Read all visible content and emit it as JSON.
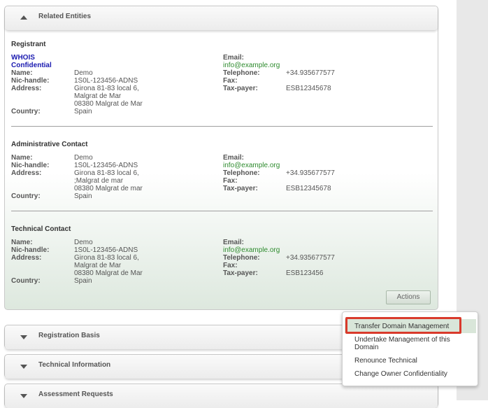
{
  "panels": {
    "related": "Related Entities",
    "registration": "Registration Basis",
    "technical_info": "Technical Information",
    "assessment": "Assessment Requests"
  },
  "registrant": {
    "title": "Registrant",
    "whois_line1": "WHOIS",
    "whois_line2": "Confidential",
    "name_label": "Name:",
    "name": "Demo",
    "nic_label": "Nic-handle:",
    "nic": "1S0L-123456-ADNS",
    "address_label": "Address:",
    "address1": "Girona 81-83 local 6,",
    "address2": "Malgrat de Mar",
    "address3": "08380 Malgrat de Mar",
    "country_label": "Country:",
    "country": "Spain",
    "email_label": "Email:",
    "email": "info@example.org",
    "phone_label": "Telephone:",
    "phone": "+34.935677577",
    "fax_label": "Fax:",
    "tax_label": "Tax-payer:",
    "tax": "ESB12345678"
  },
  "admin": {
    "title": "Administrative Contact",
    "name_label": "Name:",
    "name": "Demo",
    "nic_label": "Nic-handle:",
    "nic": "1S0L-123456-ADNS",
    "address_label": "Address:",
    "address1": "Girona 81-83 local 6,",
    "address2": ";Malgrat de mar",
    "address3": "08380 Malgrat de mar",
    "country_label": "Country:",
    "country": "Spain",
    "email_label": "Email:",
    "email": "info@example.org",
    "phone_label": "Telephone:",
    "phone": "+34.935677577",
    "fax_label": "Fax:",
    "tax_label": "Tax-payer:",
    "tax": "ESB12345678"
  },
  "technical": {
    "title": "Technical Contact",
    "name_label": "Name:",
    "name": "Demo",
    "nic_label": "Nic-handle:",
    "nic": "1S0L-123456-ADNS",
    "address_label": "Address:",
    "address1": "Girona 81-83 local 6,",
    "address2": "Malgrat de Mar",
    "address3": "08380 Malgrat de Mar",
    "country_label": "Country:",
    "country": "Spain",
    "email_label": "Email:",
    "email": "info@example.org",
    "phone_label": "Telephone:",
    "phone": "+34.935677577",
    "fax_label": "Fax:",
    "tax_label": "Tax-payer:",
    "tax": "ESB123456"
  },
  "actions": {
    "button_label": "Actions",
    "items": [
      "Transfer Domain Management",
      "Undertake Management of this Domain",
      "Renounce Technical",
      "Change Owner Confidentiality"
    ]
  },
  "colors": {
    "link": "#2e8b2e",
    "whois": "#1a1ab0",
    "highlight": "#d93a2b"
  }
}
